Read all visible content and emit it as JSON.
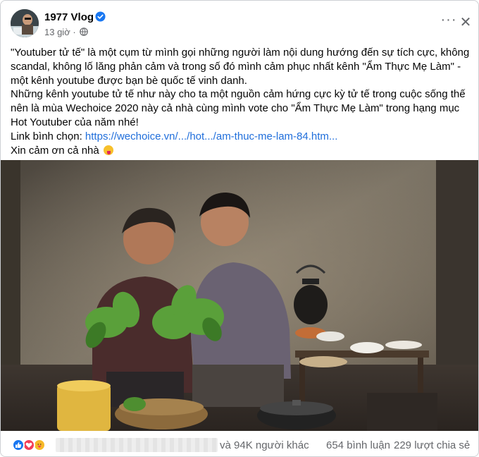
{
  "post": {
    "author": "1977 Vlog",
    "time": "13 giờ",
    "middot": "·",
    "more_label": "···",
    "close_label": "✕",
    "paragraphs": [
      "\"Youtuber tử tế\" là một cụm từ mình gọi những người làm nội dung hướng đến sự tích cực, không scandal, không lố lăng phản cảm và trong số đó mình cảm phục nhất kênh \"Ẩm Thực Mẹ Làm\" - một kênh youtube được bạn bè quốc tế vinh danh.",
      "Những kênh youtube tử tế như này cho ta một nguồn cảm hứng cực kỳ tử tế trong cuộc sống thế nên là mùa Wechoice 2020 này cả nhà cùng mình vote cho \"Ẩm Thực Mẹ Làm\" trong hạng mục Hot Youtuber của năm nhé!"
    ],
    "link_prefix": "Link bình chọn: ",
    "link_text": "https://wechoice.vn/.../hot.../am-thuc-me-lam-84.htm...",
    "thanks": "Xin cảm ơn cả nhà",
    "icons": {
      "verified": "verified-badge-icon",
      "audience": "globe-icon",
      "emoji": "tongue-out-emoji"
    },
    "colors": {
      "link": "#216fdb",
      "verified": "#1877f2",
      "secondary_text": "#65676b"
    }
  },
  "footer": {
    "reactions": [
      "like",
      "love",
      "care"
    ],
    "others": "và 94K người khác",
    "comments": "654 bình luận",
    "shares": "229 lượt chia sẻ"
  }
}
